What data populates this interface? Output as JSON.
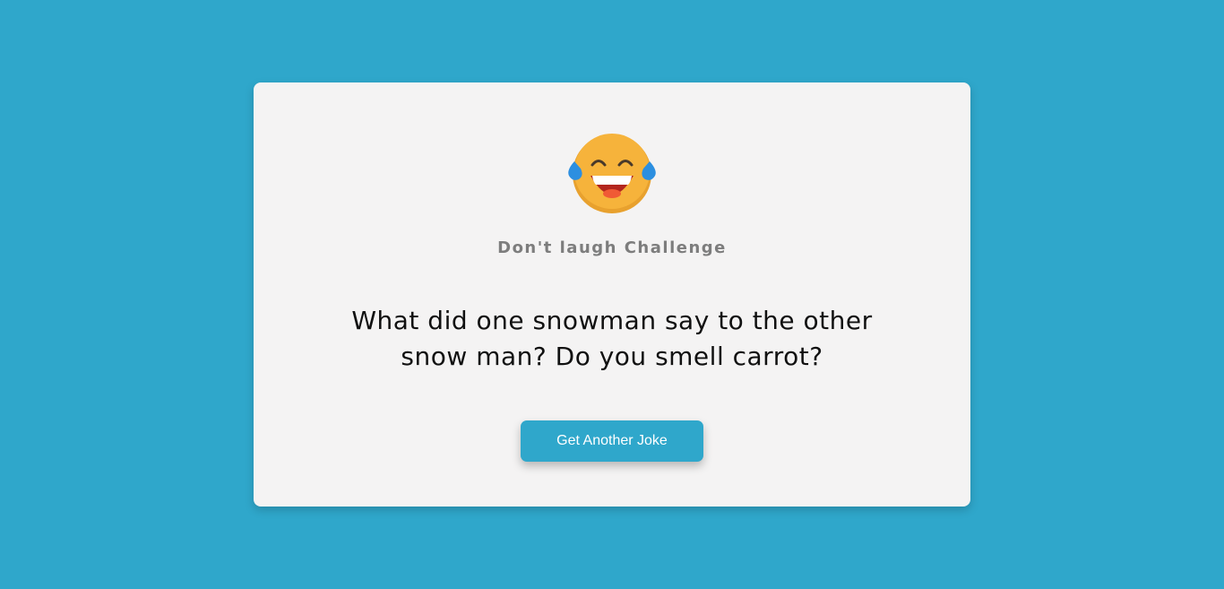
{
  "card": {
    "icon": "laughing-tears-emoji-icon",
    "title": "Don't laugh Challenge",
    "joke": "What did one snowman say to the other snow man? Do you smell carrot?",
    "button_label": "Get Another Joke"
  },
  "colors": {
    "background": "#2fa7cb",
    "card": "#f4f3f3",
    "accent": "#2fa7cb",
    "title": "#7d7d7d",
    "joke_text": "#111111"
  }
}
